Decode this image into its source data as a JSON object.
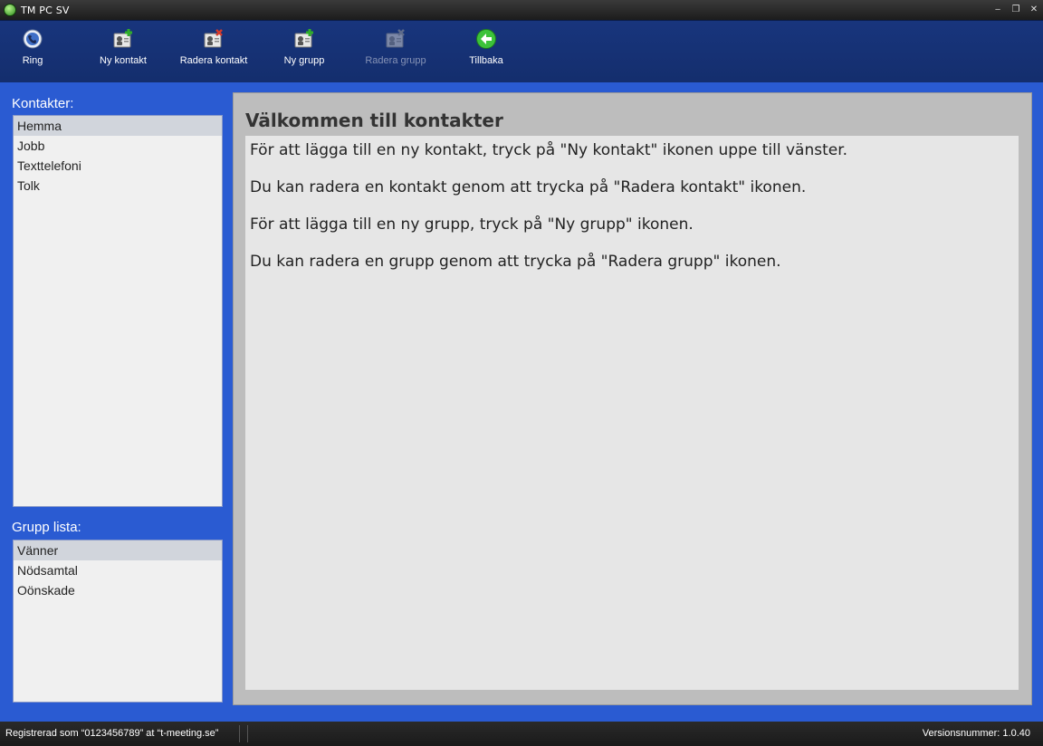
{
  "window": {
    "title": "TM PC SV",
    "controls": {
      "minimize": "‒",
      "restore": "❐",
      "close": "✕"
    }
  },
  "toolbar": {
    "items": [
      {
        "label": "Ring",
        "icon": "phone-globe-icon",
        "enabled": true
      },
      {
        "label": "Ny kontakt",
        "icon": "add-contact-icon",
        "enabled": true
      },
      {
        "label": "Radera kontakt",
        "icon": "delete-contact-icon",
        "enabled": true
      },
      {
        "label": "Ny grupp",
        "icon": "add-group-icon",
        "enabled": true
      },
      {
        "label": "Radera grupp",
        "icon": "delete-group-icon",
        "enabled": false
      },
      {
        "label": "Tillbaka",
        "icon": "back-arrow-icon",
        "enabled": true
      }
    ]
  },
  "contacts": {
    "label": "Kontakter:",
    "items": [
      "Hemma",
      "Jobb",
      "Texttelefoni",
      "Tolk"
    ],
    "selected": "Hemma"
  },
  "groups": {
    "label": "Grupp lista:",
    "items": [
      "Vänner",
      "Nödsamtal",
      "Oönskade"
    ],
    "selected": "Vänner"
  },
  "panel": {
    "title": "Välkommen till kontakter",
    "paragraphs": [
      "För att lägga till en ny kontakt, tryck på \"Ny kontakt\" ikonen uppe till vänster.",
      "Du kan radera en kontakt genom att trycka på \"Radera kontakt\" ikonen.",
      "För att lägga till en ny grupp, tryck på \"Ny grupp\" ikonen.",
      "Du kan radera en grupp genom att trycka på \"Radera grupp\" ikonen."
    ]
  },
  "status": {
    "registered": "Registrerad som “0123456789” at “t-meeting.se”",
    "version": "Versionsnummer: 1.0.40"
  },
  "colors": {
    "toolbar_bg": "#18357d",
    "content_bg": "#2a5bd2",
    "panel_bg": "#bdbdbd",
    "accent_green": "#2fae2a",
    "delete_red": "#d83a2a"
  }
}
